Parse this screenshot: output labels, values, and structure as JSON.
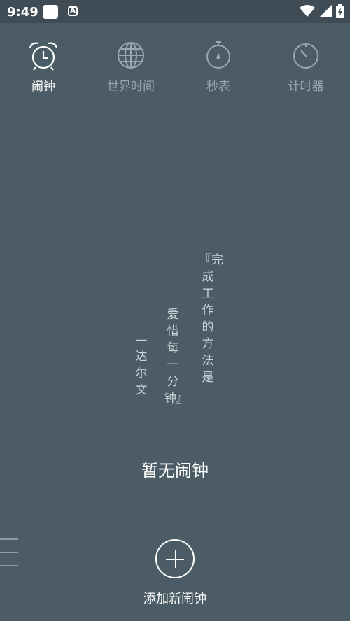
{
  "status_bar": {
    "time": "9:49",
    "notification_badge": "A"
  },
  "tabs": [
    {
      "label": "闹钟",
      "icon": "alarm-clock-icon",
      "active": true
    },
    {
      "label": "世界时间",
      "icon": "globe-icon",
      "active": false
    },
    {
      "label": "秒表",
      "icon": "stopwatch-icon",
      "active": false
    },
    {
      "label": "计时器",
      "icon": "timer-icon",
      "active": false
    }
  ],
  "quote": {
    "line1": "『完成工作的方法是",
    "line2": "爱惜每一分钟』",
    "line3": "—达尔文"
  },
  "empty_text": "暂无闹钟",
  "add_label": "添加新闹钟",
  "colors": {
    "background": "#4c5c66",
    "status_bar": "#3f4c55",
    "dim_text": "#98a6ae"
  }
}
